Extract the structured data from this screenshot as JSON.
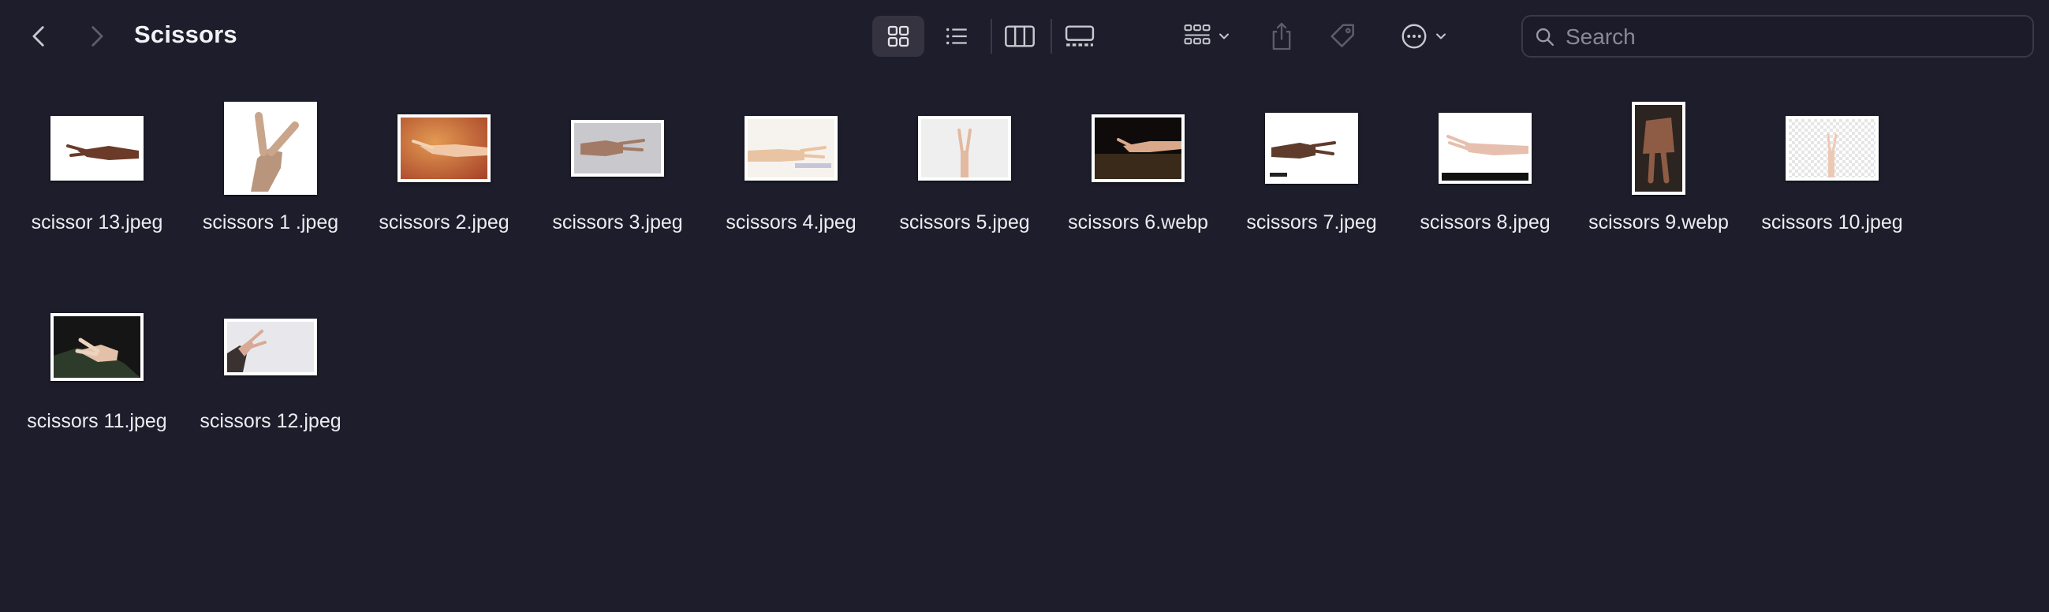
{
  "window": {
    "title": "Scissors"
  },
  "toolbar": {
    "search_placeholder": "Search"
  },
  "files": [
    {
      "name": "scissor 13.jpeg"
    },
    {
      "name": "scissors 1 .jpeg"
    },
    {
      "name": "scissors 2.jpeg"
    },
    {
      "name": "scissors 3.jpeg"
    },
    {
      "name": "scissors 4.jpeg"
    },
    {
      "name": "scissors 5.jpeg"
    },
    {
      "name": "scissors 6.webp"
    },
    {
      "name": "scissors 7.jpeg"
    },
    {
      "name": "scissors 8.jpeg"
    },
    {
      "name": "scissors 9.webp"
    },
    {
      "name": "scissors 10.jpeg"
    },
    {
      "name": "scissors 11.jpeg"
    },
    {
      "name": "scissors 12.jpeg"
    }
  ]
}
